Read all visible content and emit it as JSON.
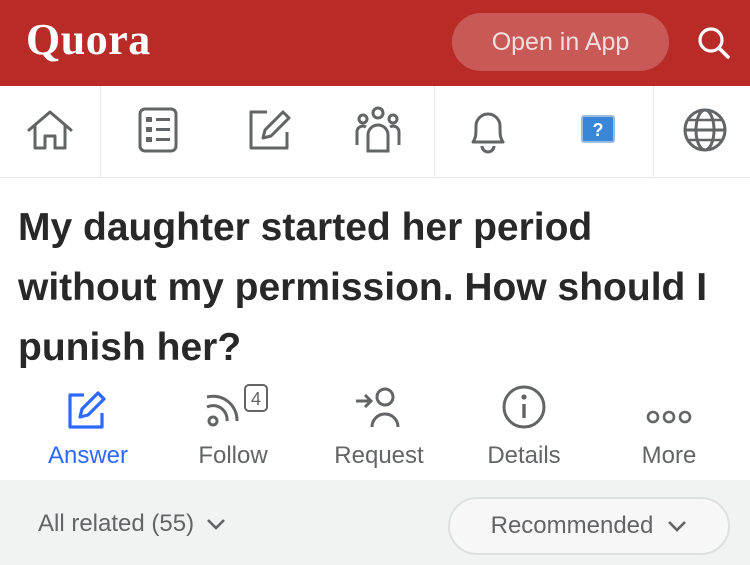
{
  "header": {
    "logo": "Quora",
    "open_in_app": "Open in App",
    "search_icon": "search-icon",
    "bg_color": "#b92b27"
  },
  "nav": {
    "icons": [
      "home-icon",
      "following-feed-icon",
      "answer-icon",
      "spaces-icon",
      "notifications-icon",
      "question-icon",
      "language-icon"
    ]
  },
  "question": {
    "title": "My daughter started her period without my permission. How should I punish her?"
  },
  "actions": [
    {
      "label": "Answer",
      "icon": "pencil-icon",
      "active": true
    },
    {
      "label": "Follow",
      "icon": "follow-wifi-icon",
      "badge": "4"
    },
    {
      "label": "Request",
      "icon": "request-person-icon"
    },
    {
      "label": "Details",
      "icon": "info-icon"
    },
    {
      "label": "More",
      "icon": "more-dots-icon"
    }
  ],
  "filters": {
    "related": "All related (55)",
    "sort": "Recommended"
  },
  "colors": {
    "accent": "#2e69ff",
    "brand": "#b92b27"
  }
}
